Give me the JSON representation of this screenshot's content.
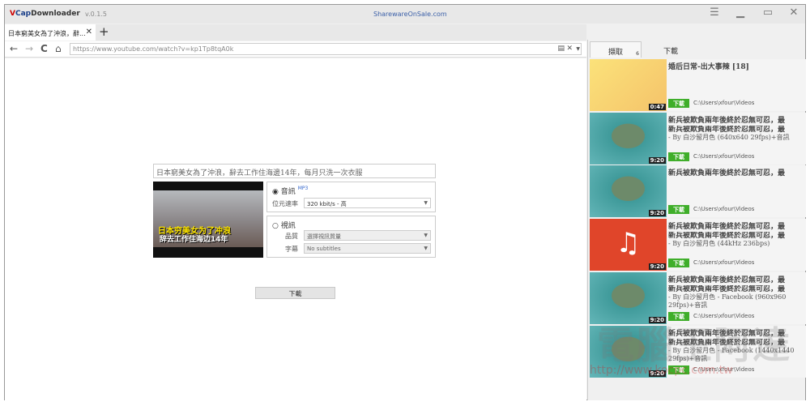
{
  "app": {
    "logo_v": "V",
    "logo_cap": "Cap",
    "logo_rest": "Downloader",
    "version": "v.0.1.5",
    "sponsor": "SharewareOnSale.com"
  },
  "window_controls": {
    "menu": "☰",
    "minimize": "▁",
    "maximize": "▭",
    "close": "✕"
  },
  "tabs": [
    {
      "label": "日本窮美女為了沖浪，辭...",
      "close": "✕"
    }
  ],
  "new_tab": "+",
  "nav": {
    "back": "←",
    "forward": "→",
    "reload": "C",
    "home": "⌂",
    "url": "https://www.youtube.com/watch?v=kp1Tp8tqA0k"
  },
  "video": {
    "title": "日本窮美女為了沖浪，辭去工作住海邊14年，每月只洗一次衣服",
    "caption1": "日本穷美女为了冲浪",
    "caption2": "辞去工作住海边14年"
  },
  "audio": {
    "label": "音訊",
    "badge": "MP3",
    "selected": true,
    "bitrate_label": "位元速率",
    "bitrate_value": "320 kbit/s - 高"
  },
  "videoopt": {
    "label": "視訊",
    "selected": false,
    "quality_label": "品質",
    "quality_value": "選擇視訊質量",
    "subs_label": "字幕",
    "subs_value": "No subtitles"
  },
  "download_button": "下載",
  "side": {
    "tab_capture": "擷取",
    "capture_count": "6",
    "tab_download": "下載"
  },
  "items": [
    {
      "title": "婚后日常-出大事辣 [18]",
      "sub": "",
      "detail": "",
      "duration": "0:47",
      "dl": "下載",
      "path": "C:\\Users\\xfour\\Videos",
      "thumb": "cartoon"
    },
    {
      "title": "新兵被欺負兩年後終於忍無可忍，最",
      "sub": "新兵被欺負兩年後終於忍無可忍，最",
      "detail": "- By 白沙留月色 (640x640 29fps)+音訊",
      "duration": "9:20",
      "dl": "下載",
      "path": "C:\\Users\\xfour\\Videos",
      "thumb": "soldier"
    },
    {
      "title": "新兵被欺負兩年後終於忍無可忍，最",
      "sub": "",
      "detail": "",
      "duration": "9:20",
      "dl": "下載",
      "path": "C:\\Users\\xfour\\Videos",
      "thumb": "soldier"
    },
    {
      "title": "新兵被欺負兩年後終於忍無可忍，最",
      "sub": "新兵被欺負兩年後終於忍無可忍，最",
      "detail": "- By 白沙留月色 (44kHz 236bps)",
      "duration": "9:20",
      "dl": "下載",
      "path": "C:\\Users\\xfour\\Videos",
      "thumb": "music"
    },
    {
      "title": "新兵被欺負兩年後終於忍無可忍，最",
      "sub": "新兵被欺負兩年後終於忍無可忍，最",
      "detail": "- By 白沙留月色 - Facebook (960x960 29fps)+音訊",
      "duration": "9:20",
      "dl": "下載",
      "path": "C:\\Users\\xfour\\Videos",
      "thumb": "soldier"
    },
    {
      "title": "新兵被欺負兩年後終於忍無可忍，最",
      "sub": "新兵被欺負兩年後終於忍無可忍，最",
      "detail": "- By 白沙留月色 - Facebook (1440x1440 29fps)+音訊",
      "duration": "9:20",
      "dl": "下載",
      "path": "C:\\Users\\xfour\\Videos",
      "thumb": "soldier"
    }
  ],
  "watermark": {
    "text": "電腦王阿達",
    "url": "http://www.kocpc.com.tw"
  },
  "colors": {
    "download_green": "#3fae2a",
    "music_red": "#e0452a",
    "link_blue": "#3a5fa8"
  }
}
